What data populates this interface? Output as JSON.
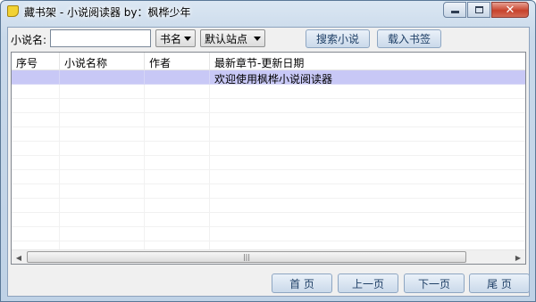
{
  "window": {
    "title": "藏书架 - 小说阅读器 by：枫桦少年",
    "icon": "bookshelf-icon"
  },
  "toolbar": {
    "name_label": "小说名:",
    "name_value": "",
    "field_select": "书名",
    "site_select": "默认站点",
    "search_button": "搜索小说",
    "bookmark_button": "载入书签"
  },
  "grid": {
    "columns": [
      "序号",
      "小说名称",
      "作者",
      "最新章节-更新日期"
    ],
    "rows": [
      [
        "",
        "",
        "",
        "欢迎使用枫桦小说阅读器"
      ]
    ],
    "selected_color": "#c8c8f6"
  },
  "pager": {
    "first": "首 页",
    "prev": "上一页",
    "next": "下一页",
    "last": "尾 页"
  }
}
